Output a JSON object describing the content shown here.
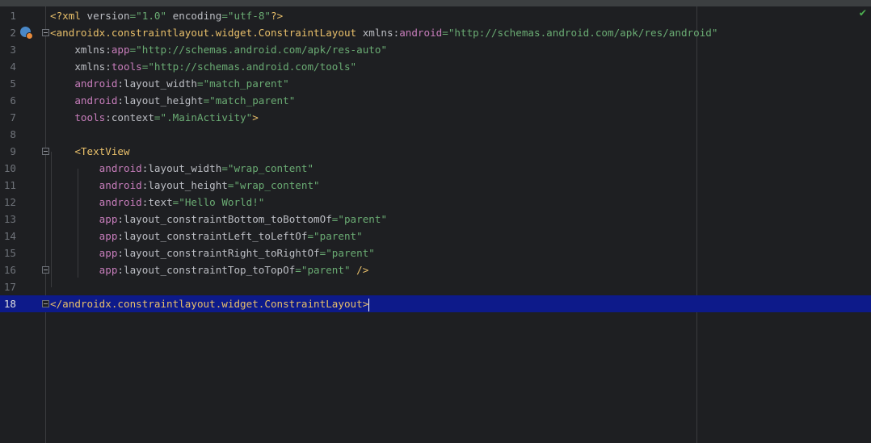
{
  "editor": {
    "status_check": "✔",
    "lines": [
      {
        "n": "1",
        "tokens": [
          {
            "t": "<?xml ",
            "c": "tg"
          },
          {
            "t": "version",
            "c": "at"
          },
          {
            "t": "=\"1.0\" ",
            "c": "st"
          },
          {
            "t": "encoding",
            "c": "at"
          },
          {
            "t": "=\"utf-8\"",
            "c": "st"
          },
          {
            "t": "?>",
            "c": "tg"
          }
        ]
      },
      {
        "n": "2",
        "tokens": [
          {
            "t": "<androidx.constraintlayout.widget.ConstraintLayout ",
            "c": "tg"
          },
          {
            "t": "xmlns:",
            "c": "at"
          },
          {
            "t": "android",
            "c": "ns"
          },
          {
            "t": "=\"http://schemas.android.com/apk/res/android\"",
            "c": "st"
          }
        ]
      },
      {
        "n": "3",
        "tokens": [
          {
            "t": "    xmlns:",
            "c": "at"
          },
          {
            "t": "app",
            "c": "ns"
          },
          {
            "t": "=\"http://schemas.android.com/apk/res-auto\"",
            "c": "st"
          }
        ]
      },
      {
        "n": "4",
        "tokens": [
          {
            "t": "    xmlns:",
            "c": "at"
          },
          {
            "t": "tools",
            "c": "ns"
          },
          {
            "t": "=\"http://schemas.android.com/tools\"",
            "c": "st"
          }
        ]
      },
      {
        "n": "5",
        "tokens": [
          {
            "t": "    android",
            "c": "ns"
          },
          {
            "t": ":layout_width",
            "c": "at"
          },
          {
            "t": "=\"match_parent\"",
            "c": "st"
          }
        ]
      },
      {
        "n": "6",
        "tokens": [
          {
            "t": "    android",
            "c": "ns"
          },
          {
            "t": ":layout_height",
            "c": "at"
          },
          {
            "t": "=\"match_parent\"",
            "c": "st"
          }
        ]
      },
      {
        "n": "7",
        "tokens": [
          {
            "t": "    tools",
            "c": "ns"
          },
          {
            "t": ":context",
            "c": "at"
          },
          {
            "t": "=\".MainActivity\"",
            "c": "st"
          },
          {
            "t": ">",
            "c": "tg"
          }
        ]
      },
      {
        "n": "8",
        "tokens": []
      },
      {
        "n": "9",
        "tokens": [
          {
            "t": "    <TextView",
            "c": "tg"
          }
        ]
      },
      {
        "n": "10",
        "tokens": [
          {
            "t": "        android",
            "c": "ns"
          },
          {
            "t": ":layout_width",
            "c": "at"
          },
          {
            "t": "=\"wrap_content\"",
            "c": "st"
          }
        ]
      },
      {
        "n": "11",
        "tokens": [
          {
            "t": "        android",
            "c": "ns"
          },
          {
            "t": ":layout_height",
            "c": "at"
          },
          {
            "t": "=\"wrap_content\"",
            "c": "st"
          }
        ]
      },
      {
        "n": "12",
        "tokens": [
          {
            "t": "        android",
            "c": "ns"
          },
          {
            "t": ":text",
            "c": "at"
          },
          {
            "t": "=\"Hello World!\"",
            "c": "st"
          }
        ]
      },
      {
        "n": "13",
        "tokens": [
          {
            "t": "        app",
            "c": "ns"
          },
          {
            "t": ":layout_constraintBottom_toBottomOf",
            "c": "at"
          },
          {
            "t": "=\"parent\"",
            "c": "st"
          }
        ]
      },
      {
        "n": "14",
        "tokens": [
          {
            "t": "        app",
            "c": "ns"
          },
          {
            "t": ":layout_constraintLeft_toLeftOf",
            "c": "at"
          },
          {
            "t": "=\"parent\"",
            "c": "st"
          }
        ]
      },
      {
        "n": "15",
        "tokens": [
          {
            "t": "        app",
            "c": "ns"
          },
          {
            "t": ":layout_constraintRight_toRightOf",
            "c": "at"
          },
          {
            "t": "=\"parent\"",
            "c": "st"
          }
        ]
      },
      {
        "n": "16",
        "tokens": [
          {
            "t": "        app",
            "c": "ns"
          },
          {
            "t": ":layout_constraintTop_toTopOf",
            "c": "at"
          },
          {
            "t": "=\"parent\" ",
            "c": "st"
          },
          {
            "t": "/>",
            "c": "tg"
          }
        ]
      },
      {
        "n": "17",
        "tokens": []
      },
      {
        "n": "18",
        "tokens": [
          {
            "t": "</androidx.constraintlayout.widget.ConstraintLayout>",
            "c": "tg"
          }
        ]
      }
    ],
    "current_line": "18"
  }
}
